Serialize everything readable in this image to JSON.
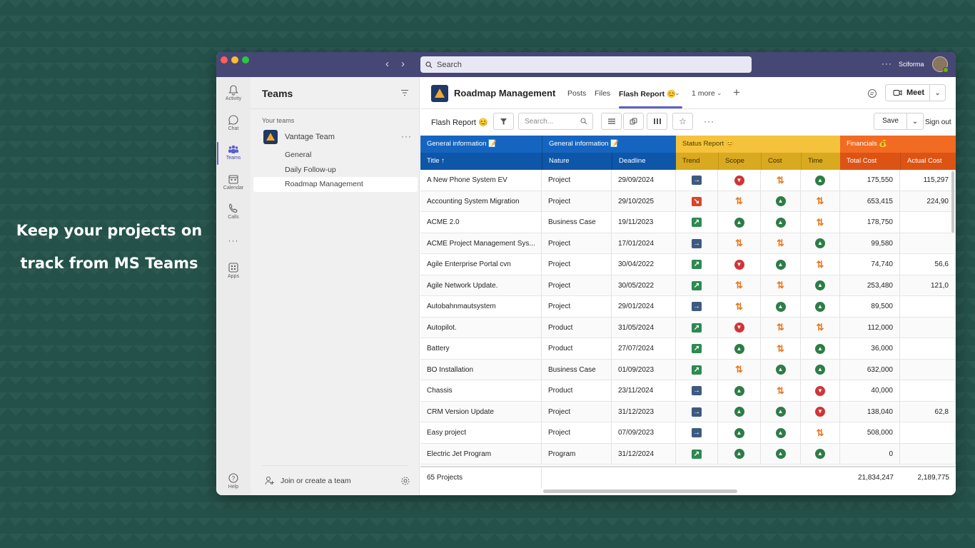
{
  "promo": {
    "line1": "Keep your projects on",
    "line2": "track from MS Teams"
  },
  "titlebar": {
    "search_placeholder": "Search",
    "more": "···",
    "org": "Sciforma"
  },
  "rail": [
    {
      "label": "Activity",
      "icon": "bell-icon"
    },
    {
      "label": "Chat",
      "icon": "chat-icon"
    },
    {
      "label": "Teams",
      "icon": "teams-icon"
    },
    {
      "label": "Calendar",
      "icon": "calendar-icon"
    },
    {
      "label": "Calls",
      "icon": "phone-icon"
    },
    {
      "label": "···",
      "icon": "more-icon"
    },
    {
      "label": "Apps",
      "icon": "apps-icon"
    },
    {
      "label": "Help",
      "icon": "help-icon"
    }
  ],
  "teams_panel": {
    "title": "Teams",
    "section": "Your teams",
    "team": "Vantage Team",
    "team_more": "···",
    "channels": [
      "General",
      "Daily Follow-up",
      "Roadmap Management"
    ],
    "join": "Join or create a team"
  },
  "app": {
    "title": "Roadmap Management",
    "tabs": [
      "Posts",
      "Files",
      "Flash Report 😊",
      "1 more"
    ],
    "meet": "Meet"
  },
  "toolbar": {
    "view_label": "Flash Report 😊",
    "search_placeholder": "Search...",
    "save": "Save",
    "sign_out": "Sign out",
    "more": "···"
  },
  "grid": {
    "group_headers": [
      "General information 📝",
      "General information 📝",
      "Status Report 😊",
      "Financials 💰"
    ],
    "columns": [
      "Title ↑",
      "Nature",
      "Deadline",
      "Trend",
      "Scope",
      "Cost",
      "Time",
      "Total Cost",
      "Actual Cost"
    ],
    "rows": [
      {
        "title": "A New Phone System EV",
        "nature": "Project",
        "deadline": "29/09/2024",
        "trend": "right",
        "scope": "bad",
        "cost": "warn",
        "time": "ok",
        "total": "175,550",
        "actual": "115,297"
      },
      {
        "title": "Accounting System Migration",
        "nature": "Project",
        "deadline": "29/10/2025",
        "trend": "down",
        "scope": "warn",
        "cost": "ok",
        "time": "warn",
        "total": "653,415",
        "actual": "224,90"
      },
      {
        "title": "ACME 2.0",
        "nature": "Business Case",
        "deadline": "19/11/2023",
        "trend": "up",
        "scope": "ok",
        "cost": "ok",
        "time": "warn",
        "total": "178,750",
        "actual": ""
      },
      {
        "title": "ACME Project Management Sys...",
        "nature": "Project",
        "deadline": "17/01/2024",
        "trend": "right",
        "scope": "warn",
        "cost": "warn",
        "time": "ok",
        "total": "99,580",
        "actual": ""
      },
      {
        "title": "Agile Enterprise Portal cvn",
        "nature": "Project",
        "deadline": "30/04/2022",
        "trend": "up",
        "scope": "bad",
        "cost": "ok",
        "time": "warn",
        "total": "74,740",
        "actual": "56,6"
      },
      {
        "title": "Agile Network Update.",
        "nature": "Project",
        "deadline": "30/05/2022",
        "trend": "up",
        "scope": "warn",
        "cost": "warn",
        "time": "ok",
        "total": "253,480",
        "actual": "121,0"
      },
      {
        "title": "Autobahnmautsystem",
        "nature": "Project",
        "deadline": "29/01/2024",
        "trend": "right",
        "scope": "warn",
        "cost": "ok",
        "time": "ok",
        "total": "89,500",
        "actual": ""
      },
      {
        "title": "Autopilot.",
        "nature": "Product",
        "deadline": "31/05/2024",
        "trend": "up",
        "scope": "bad",
        "cost": "warn",
        "time": "warn",
        "total": "112,000",
        "actual": ""
      },
      {
        "title": "Battery",
        "nature": "Product",
        "deadline": "27/07/2024",
        "trend": "up",
        "scope": "ok",
        "cost": "warn",
        "time": "ok",
        "total": "36,000",
        "actual": ""
      },
      {
        "title": "BO Installation",
        "nature": "Business Case",
        "deadline": "01/09/2023",
        "trend": "up",
        "scope": "warn",
        "cost": "ok",
        "time": "ok",
        "total": "632,000",
        "actual": ""
      },
      {
        "title": "Chassis",
        "nature": "Product",
        "deadline": "23/11/2024",
        "trend": "right",
        "scope": "ok",
        "cost": "warn",
        "time": "bad",
        "total": "40,000",
        "actual": ""
      },
      {
        "title": "CRM Version Update",
        "nature": "Project",
        "deadline": "31/12/2023",
        "trend": "right",
        "scope": "ok",
        "cost": "ok",
        "time": "bad",
        "total": "138,040",
        "actual": "62,8"
      },
      {
        "title": "Easy project",
        "nature": "Project",
        "deadline": "07/09/2023",
        "trend": "right",
        "scope": "ok",
        "cost": "ok",
        "time": "warn",
        "total": "508,000",
        "actual": ""
      },
      {
        "title": "Electric Jet Program",
        "nature": "Program",
        "deadline": "31/12/2024",
        "trend": "up",
        "scope": "ok",
        "cost": "ok",
        "time": "ok",
        "total": "0",
        "actual": ""
      }
    ],
    "footer": {
      "count": "65 Projects",
      "total": "21,834,247",
      "actual": "2,189,775"
    }
  },
  "colors": {
    "titlebar": "#464775",
    "accent": "#5b5fc7",
    "general_info": "#1565c0",
    "status": "#f5c33b",
    "financials": "#f26b22",
    "trend_right": "#3d5a80",
    "trend_up": "#2d8a52",
    "trend_down": "#d9452b"
  }
}
